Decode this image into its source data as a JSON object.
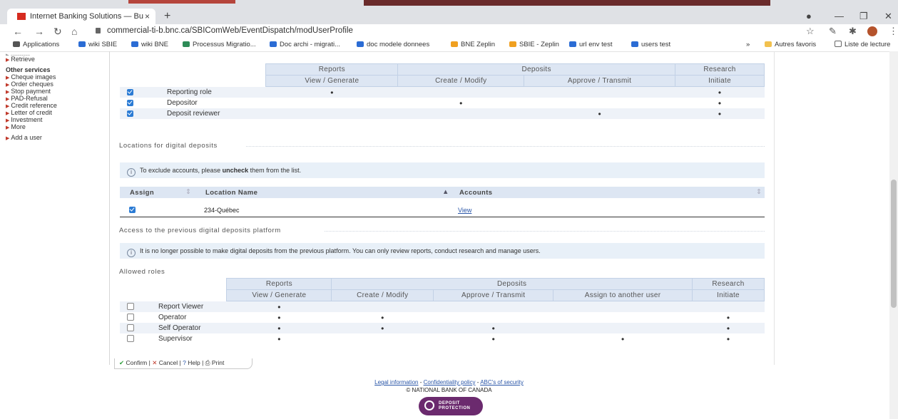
{
  "browser": {
    "tab_title": "Internet Banking Solutions — Bu",
    "tab_close": "×",
    "new_tab": "+",
    "url": "commercial-ti-b.bnc.ca/SBIComWeb/EventDispatch/modUserProfile",
    "bookmarks": [
      {
        "label": "Applications",
        "color": "#555555"
      },
      {
        "label": "wiki SBIE",
        "color": "#2b6cd4"
      },
      {
        "label": "wiki BNE",
        "color": "#2b6cd4"
      },
      {
        "label": "Processus Migratio...",
        "color": "#2e8b57"
      },
      {
        "label": "Doc archi - migrati...",
        "color": "#2b6cd4"
      },
      {
        "label": "doc modele donnees",
        "color": "#2b6cd4"
      },
      {
        "label": "BNE Zeplin",
        "color": "#f0a020"
      },
      {
        "label": "SBIE - Zeplin",
        "color": "#f0a020"
      },
      {
        "label": "url env test",
        "color": "#2b6cd4"
      },
      {
        "label": "users test",
        "color": "#2b6cd4"
      }
    ],
    "other_bookmarks": "Autres favoris",
    "reading_list": "Liste de lecture",
    "chevron": "»"
  },
  "sidebar": {
    "retrieve": "Retrieve",
    "other_services_heading": "Other services",
    "items": [
      "Cheque images",
      "Order cheques",
      "Stop payment",
      "PAD-Refusal",
      "Credit reference",
      "Letter of credit",
      "Investment",
      "More"
    ],
    "add_user": "Add a user"
  },
  "roles_table": {
    "groups": [
      "Reports",
      "Deposits",
      "Research"
    ],
    "subheaders": [
      "View / Generate",
      "Create / Modify",
      "Approve / Transmit",
      "Initiate"
    ],
    "rows": [
      {
        "label": "Reporting role",
        "checked": true,
        "marks": [
          "•",
          "",
          "",
          "•"
        ]
      },
      {
        "label": "Depositor",
        "checked": true,
        "marks": [
          "",
          "•",
          "",
          "•"
        ]
      },
      {
        "label": "Deposit reviewer",
        "checked": true,
        "marks": [
          "",
          "",
          "•",
          "•"
        ]
      }
    ]
  },
  "locations": {
    "title": "Locations for digital deposits",
    "info_prefix": "To exclude accounts, please ",
    "info_bold": "uncheck",
    "info_suffix": " them from the list.",
    "col_assign": "Assign",
    "col_location": "Location Name",
    "col_accounts": "Accounts",
    "row_location": "234-Québec",
    "row_link": "View"
  },
  "previous_platform": {
    "title": "Access to the previous digital deposits platform",
    "info": "It is no longer possible to make digital deposits from the previous platform. You can only review reports, conduct research and manage users.",
    "allowed_roles": "Allowed roles",
    "groups": [
      "Reports",
      "Deposits",
      "Research"
    ],
    "subheaders": [
      "View / Generate",
      "Create / Modify",
      "Approve / Transmit",
      "Assign to another user",
      "Initiate"
    ],
    "rows": [
      {
        "label": "Report Viewer",
        "marks": [
          "•",
          "",
          "",
          "",
          ""
        ]
      },
      {
        "label": "Operator",
        "marks": [
          "•",
          "•",
          "",
          "",
          "•"
        ]
      },
      {
        "label": "Self Operator",
        "marks": [
          "•",
          "•",
          "•",
          "",
          "•"
        ]
      },
      {
        "label": "Supervisor",
        "marks": [
          "•",
          "",
          "•",
          "•",
          "•"
        ]
      }
    ]
  },
  "actions": {
    "confirm": "Confirm",
    "cancel": "Cancel",
    "help": "Help",
    "print": "Print"
  },
  "footer": {
    "legal": "Legal information",
    "privacy": "Confidentiality policy",
    "security": "ABC's of security",
    "sep": " - ",
    "copyright": "© NATIONAL BANK OF CANADA",
    "badge_line1": "DEPOSIT",
    "badge_line2": "PROTECTION"
  },
  "colors": {
    "accent": "#2b7bd4",
    "header_bg": "#dde6f3",
    "link": "#2a56a8",
    "badge": "#6b2a6e"
  }
}
